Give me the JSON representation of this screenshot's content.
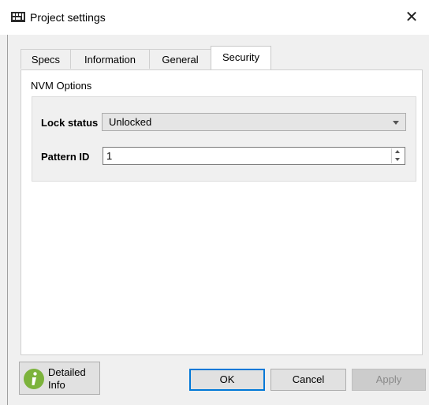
{
  "window": {
    "title": "Project settings",
    "close_glyph": "✕"
  },
  "tabs": [
    {
      "label": "Specs",
      "active": false
    },
    {
      "label": "Information",
      "active": false
    },
    {
      "label": "General",
      "active": false
    },
    {
      "label": "Security",
      "active": true
    }
  ],
  "security": {
    "group_title": "NVM Options",
    "lock_status": {
      "label": "Lock status",
      "value": "Unlocked"
    },
    "pattern_id": {
      "label": "Pattern ID",
      "value": "1"
    }
  },
  "footer": {
    "detailed_info_line1": "Detailed",
    "detailed_info_line2": "Info",
    "ok_label": "OK",
    "cancel_label": "Cancel",
    "apply_label": "Apply"
  },
  "icons": {
    "app": "chip-icon",
    "info": "info-icon",
    "close": "close-icon"
  },
  "colors": {
    "info_green": "#7cb33c",
    "focus_blue": "#0078d7"
  }
}
